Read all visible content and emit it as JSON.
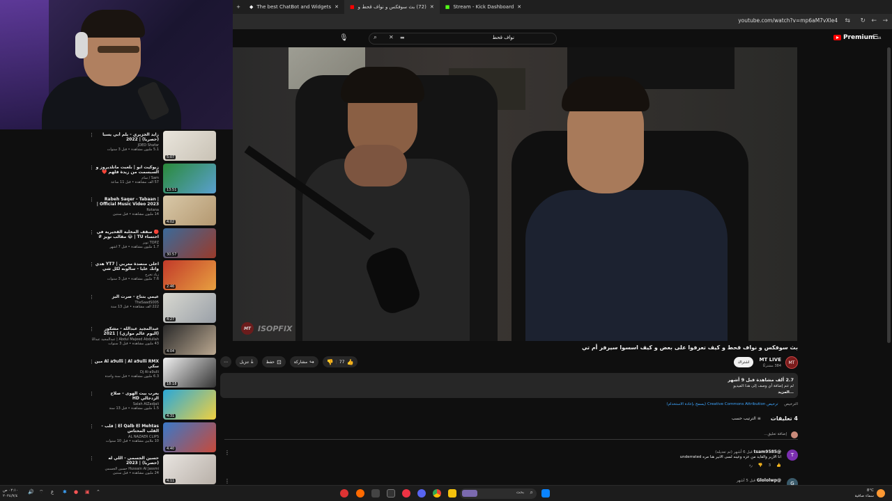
{
  "browser": {
    "tabs": [
      {
        "label": "Stream - Kick Dashboard",
        "active": false
      },
      {
        "label": "(72) بث سوفكس و نواف قحط و",
        "active": true
      },
      {
        "label": "The best ChatBot and Widgets",
        "active": false
      }
    ],
    "url": "youtube.com/watch?v=mp6aM7vXle4"
  },
  "youtube": {
    "search_query": "نواف قحط",
    "premium_label": "Premium",
    "premium_sup": "SA"
  },
  "player": {
    "watermark": "ISOPFIX",
    "watermark_badge": "MT"
  },
  "video": {
    "title": "بث سوفكس و نواف قحط و كيف تعرفوا على بعض و كيف اسسوا سيرفر أم تي",
    "channel": "MT LIVE",
    "channel_badge": "MT",
    "subscribers": "384 مشتركًا",
    "subscribe_label": "اشتراك",
    "likes": "77",
    "share_label": "مشاركة",
    "save_label": "حفظ",
    "download_label": "تنزيل",
    "views_line": "2.7 ألف مشاهدة قبل 9 أشهر",
    "description": "لم تتم إضافة أي وصف إلى هذا الفيديو",
    "more_label": "...المزيد",
    "license_prefix": "الترخيص",
    "license_label": "ترخيص Creative Commons Attribution",
    "license_suffix": "(يسمح بإعادة الاستخدام)"
  },
  "comments": {
    "count_label": "4 تعليقات",
    "sort_label": "الترتيب حسب",
    "add_placeholder": "إضافة تعليق...",
    "items": [
      {
        "author": "@tsam9585",
        "time": "قبل 6 أشهر (تم تعديله)",
        "text": "انا الازبر والقايد من عزه وعينه لسى الانير هنا مره underrated",
        "likes": "3",
        "reply": "رد",
        "avatar": "T"
      },
      {
        "author": "@Glololwp",
        "time": "قبل 5 أشهر",
        "text": "",
        "likes": "",
        "reply": "",
        "avatar": "G"
      }
    ]
  },
  "sidebar": {
    "items": [
      {
        "title": "زايد الجزيري - يلم أبي يسبا (حصريا) | 2022",
        "channel": "JDED Shafar",
        "meta": "5.1 مليون مشاهدة • قبل 3 سنوات",
        "duration": "5:07"
      },
      {
        "title": "زيوكيت ابو | بلعبت مانلديروز و السبسمت من زيدة فلهم ❤️ (زكالة مع Trk511) ...",
        "channel": "Sam / سام",
        "meta": "57 ألف مشاهدة • قبل 11 ساعة",
        "duration": "13:51"
      },
      {
        "title": "Rabeh Saqer - Tabaan | Official Music Video 2023 | رابح صقر - طبعا",
        "channel": "Rotana",
        "meta": "14 مليون مشاهدة • قبل سنتين",
        "duration": "4:02"
      },
      {
        "title": "🔴 سقف المخلبة القحيرية في احتساء TU | 😂 مقالب تويز #",
        "channel": "TOPZ تويز",
        "meta": "1.7 مليون مشاهدة • قبل 7 أشهر",
        "duration": "30:57"
      },
      {
        "title": "اعلى منصدة مغربي | YT7 هدي وانك عليا - سالوبه لكل شي فساوبه لاغاني...",
        "channel": "زياد تخرج",
        "meta": "7.6 مليون مشاهدة • قبل 3 سنوات",
        "duration": "2:46"
      },
      {
        "title": "عيمي بتناح - صرت البز",
        "channel": "TheSaadS005",
        "meta": "222 ألف مشاهدة • قبل 13 سنة",
        "duration": "4:27"
      },
      {
        "title": "عبدالمجيد عبدالله - مشكور (البوم عالم موازي) | 2021",
        "channel": "Abdul Majeed Abdullah | عبدالمجيد عبدالله",
        "meta": "43 مليون مشاهدة • قبل 3 سنوات",
        "duration": "4:04"
      },
      {
        "title": "Al a9ulli | Al a9ulli RMX مين سكي",
        "channel": "Dj Al-a9ulli",
        "meta": "6.3 مليون مشاهدة • قبل سنة واحدة",
        "duration": "18:18"
      },
      {
        "title": "يعرب بيت الهوى - صلاح الزدجالي HD",
        "channel": "Salah AlZadjali",
        "meta": "1.5 مليون مشاهدة • قبل 13 سنة",
        "duration": "4:31"
      },
      {
        "title": "El Qalb El Mehtas | قلب - القلب المحتاس",
        "channel": "AL NAZAER CLIPS",
        "meta": "10 ملايين مشاهدة • قبل 10 سنوات",
        "duration": "4:40"
      },
      {
        "title": "حسين الجسمي - اللي له (حصريا) | 2023",
        "channel": "Hussain Al Jassmi حسين الجسمي",
        "meta": "24 مليون مشاهدة • قبل سنتين",
        "duration": "4:11"
      }
    ]
  },
  "taskbar": {
    "search_placeholder": "بحث",
    "clock_time": "٠٢:١٠ ص",
    "clock_date": "٢٠٢٤/٧/٤",
    "weather_temp": "8°C",
    "weather_desc": "سماء صافية",
    "lang": "ع"
  },
  "colors": {
    "bg": "#0f0f0f",
    "accent_red": "#ff0000",
    "link_blue": "#3ea6ff",
    "pill_bg": "#272727"
  }
}
